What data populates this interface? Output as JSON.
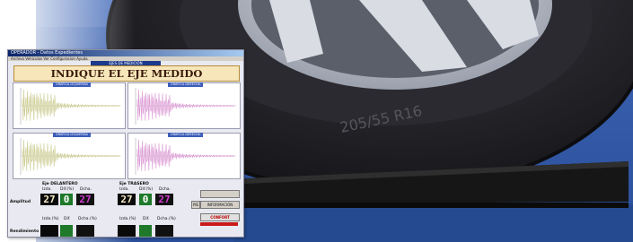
{
  "window": {
    "title": "OPERADOR  - Datos Expedientes",
    "menu": "Archivo  Vehiculos  Ver  Configuracion  Ayuda"
  },
  "screen": {
    "subtitle": "EJES DE MEDICIÓN",
    "headline": "INDIQUE EL EJE MEDIDO"
  },
  "panels": [
    {
      "title": "GRÁFICA IZQUIERDA",
      "color": "#c8c88a"
    },
    {
      "title": "GRÁFICA DERECHA",
      "color": "#d890d0"
    },
    {
      "title": "GRÁFICA IZQUIERDA",
      "color": "#c8c88a"
    },
    {
      "title": "GRÁFICA DERECHA",
      "color": "#d890d0"
    }
  ],
  "front_axle": {
    "label": "Eje DELANTERO",
    "col_left": "Izda.",
    "col_diff": "Dif.(%)",
    "col_right": "Dcha.",
    "amplitude": {
      "left": "27",
      "diff": "0",
      "right": "27"
    },
    "col_left_pct": "Izda.(%)",
    "col_diff2": "Dif.",
    "col_right_pct": "Dcha.(%)"
  },
  "rear_axle": {
    "label": "Eje TRASERO",
    "col_left": "Izda.",
    "col_diff": "Dif.(%)",
    "col_right": "Dcha.",
    "amplitude": {
      "left": "27",
      "diff": "0",
      "right": "27"
    },
    "col_left_pct": "Izda.(%)",
    "col_diff2": "Dif.",
    "col_right_pct": "Dcha.(%)"
  },
  "rows": {
    "amplitude": "Amplitud",
    "rendimiento": "Rendimiento"
  },
  "buttons": {
    "informacion": "INFORMACIÓN",
    "pie": "PIE",
    "confort": "CONFORT"
  }
}
